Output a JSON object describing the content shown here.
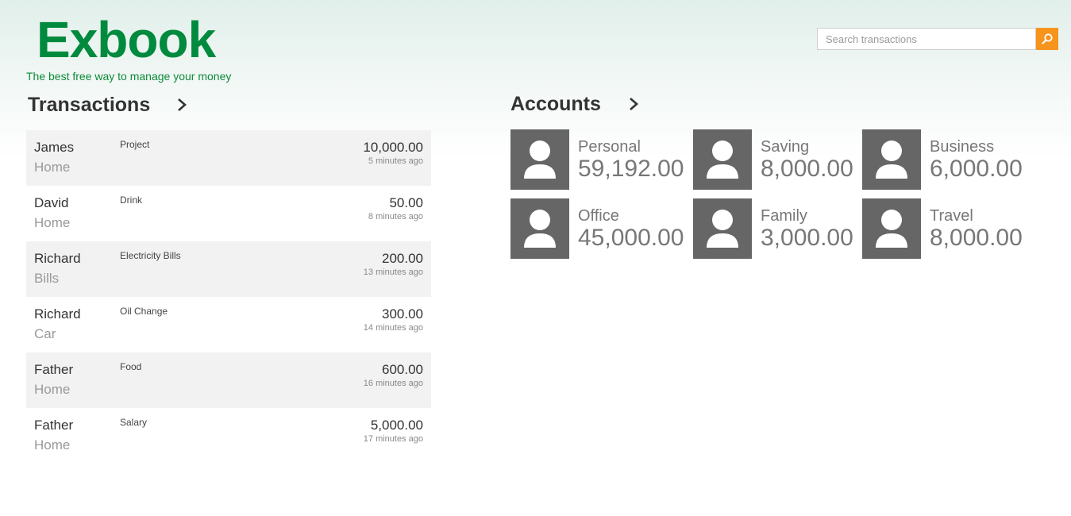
{
  "header": {
    "logo": "Exbook",
    "tagline": "The best free way to manage your money"
  },
  "search": {
    "placeholder": "Search transactions",
    "button_icon": "search-icon"
  },
  "transactions": {
    "title": "Transactions",
    "more_icon": "chevron-right-icon",
    "rows": [
      {
        "name": "James",
        "category": "Home",
        "description": "Project",
        "amount": "10,000.00",
        "time": "5 minutes ago"
      },
      {
        "name": "David",
        "category": "Home",
        "description": "Drink",
        "amount": "50.00",
        "time": "8 minutes ago"
      },
      {
        "name": "Richard",
        "category": "Bills",
        "description": "Electricity Bills",
        "amount": "200.00",
        "time": "13 minutes ago"
      },
      {
        "name": "Richard",
        "category": "Car",
        "description": "Oil Change",
        "amount": "300.00",
        "time": "14 minutes ago"
      },
      {
        "name": "Father",
        "category": "Home",
        "description": "Food",
        "amount": "600.00",
        "time": "16 minutes ago"
      },
      {
        "name": "Father",
        "category": "Home",
        "description": "Salary",
        "amount": "5,000.00",
        "time": "17 minutes ago"
      }
    ]
  },
  "accounts": {
    "title": "Accounts",
    "more_icon": "chevron-right-icon",
    "items": [
      {
        "name": "Personal",
        "balance": "59,192.00",
        "icon": "person-icon"
      },
      {
        "name": "Saving",
        "balance": "8,000.00",
        "icon": "person-icon"
      },
      {
        "name": "Business",
        "balance": "6,000.00",
        "icon": "person-icon"
      },
      {
        "name": "Office",
        "balance": "45,000.00",
        "icon": "person-icon"
      },
      {
        "name": "Family",
        "balance": "3,000.00",
        "icon": "person-icon"
      },
      {
        "name": "Travel",
        "balance": "8,000.00",
        "icon": "person-icon"
      }
    ]
  },
  "colors": {
    "brand": "#008a3e",
    "search_button": "#f7941d",
    "avatar_bg": "#666666",
    "row_alt": "#f2f2f2"
  }
}
